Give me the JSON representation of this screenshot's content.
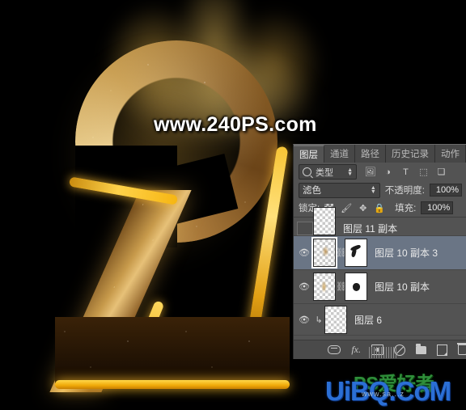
{
  "artwork": {
    "subject": "glowing golden glitter number 2 with flame",
    "watermark_top": "www.240PS.com",
    "watermark_bottom": "UiBQ.CoM",
    "watermark_bottom_cn": "PS爱好者",
    "watermark_bottom_sub": "www.sa...z",
    "colors": {
      "gold": "#ffd24a",
      "dark_gold": "#8a5f27",
      "background": "#000000"
    }
  },
  "panel": {
    "tabs": [
      {
        "label": "图层",
        "active": true
      },
      {
        "label": "通道",
        "active": false
      },
      {
        "label": "路径",
        "active": false
      },
      {
        "label": "历史记录",
        "active": false
      },
      {
        "label": "动作",
        "active": false
      }
    ],
    "filter_row": {
      "search_icon": "search-icon",
      "kind_label": "类型",
      "icons": [
        "image-filter-icon",
        "adjustment-filter-icon",
        "type-filter-icon",
        "shape-filter-icon",
        "smart-object-filter-icon"
      ],
      "type_glyph": "T"
    },
    "blend_row": {
      "mode": "滤色",
      "opacity_label": "不透明度:",
      "opacity_value": "100%"
    },
    "lock_row": {
      "lock_label": "锁定:",
      "icons": [
        "transparency-lock-icon",
        "brush-lock-icon",
        "move-lock-icon",
        "all-lock-icon"
      ],
      "fill_label": "填充:",
      "fill_value": "100%"
    },
    "layers": [
      {
        "name": "图层 11 副本",
        "visible": false,
        "selected": false,
        "has_mask": false,
        "clipped": false,
        "partial": true
      },
      {
        "name": "图层 10 副本 3",
        "visible": true,
        "selected": true,
        "has_mask": true,
        "clipped": false,
        "partial": false
      },
      {
        "name": "图层 10 副本",
        "visible": true,
        "selected": false,
        "has_mask": true,
        "clipped": false,
        "partial": false
      },
      {
        "name": "图层 6",
        "visible": true,
        "selected": false,
        "has_mask": false,
        "clipped": true,
        "partial": false
      }
    ],
    "bottom_toolbar": [
      "link-layers-icon",
      "layer-style-fx-icon",
      "add-mask-icon",
      "adjustment-layer-icon",
      "new-group-icon",
      "new-layer-icon",
      "delete-layer-icon"
    ],
    "fx_label": "fx."
  }
}
